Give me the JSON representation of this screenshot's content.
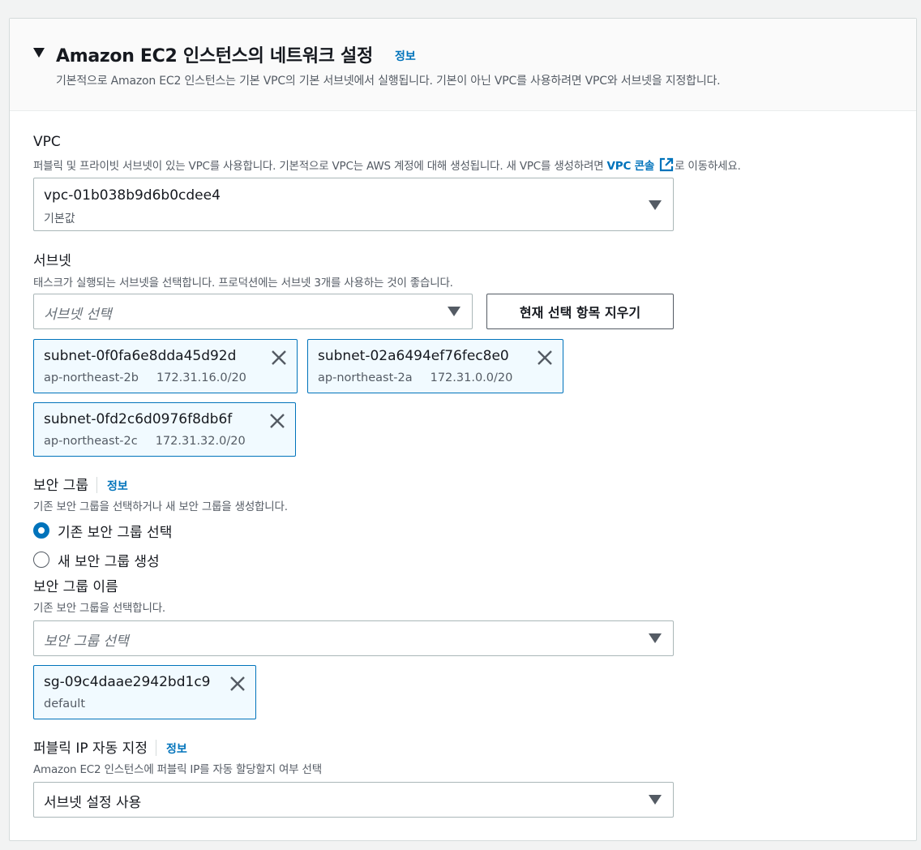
{
  "header": {
    "title": "Amazon EC2 인스턴스의 네트워크 설정",
    "info": "정보",
    "description": "기본적으로 Amazon EC2 인스턴스는 기본 VPC의 기본 서브넷에서 실행됩니다. 기본이 아닌 VPC를 사용하려면 VPC와 서브넷을 지정합니다."
  },
  "vpc": {
    "label": "VPC",
    "description_before": "퍼블릭 및 프라이빗 서브넷이 있는 VPC를 사용합니다. 기본적으로 VPC는 AWS 계정에 대해 생성됩니다. 새 VPC를 생성하려면 ",
    "console_link": "VPC 콘솔",
    "description_after": "로 이동하세요.",
    "selected_value": "vpc-01b038b9d6b0cdee4",
    "selected_sub": "기본값"
  },
  "subnet": {
    "label": "서브넷",
    "description": "태스크가 실행되는 서브넷을 선택합니다. 프로덕션에는 서브넷 3개를 사용하는 것이 좋습니다.",
    "placeholder": "서브넷 선택",
    "clear_button": "현재 선택 항목 지우기",
    "tokens": [
      {
        "id": "subnet-0f0fa6e8dda45d92d",
        "az": "ap-northeast-2b",
        "cidr": "172.31.16.0/20"
      },
      {
        "id": "subnet-02a6494ef76fec8e0",
        "az": "ap-northeast-2a",
        "cidr": "172.31.0.0/20"
      },
      {
        "id": "subnet-0fd2c6d0976f8db6f",
        "az": "ap-northeast-2c",
        "cidr": "172.31.32.0/20"
      }
    ]
  },
  "security_group": {
    "label": "보안 그룹",
    "info": "정보",
    "description": "기존 보안 그룹을 선택하거나 새 보안 그룹을 생성합니다.",
    "options": [
      {
        "label": "기존 보안 그룹 선택",
        "selected": true
      },
      {
        "label": "새 보안 그룹 생성",
        "selected": false
      }
    ],
    "name_label": "보안 그룹 이름",
    "name_description": "기존 보안 그룹을 선택합니다.",
    "placeholder": "보안 그룹 선택",
    "tokens": [
      {
        "id": "sg-09c4daae2942bd1c9",
        "name": "default"
      }
    ]
  },
  "public_ip": {
    "label": "퍼블릭 IP 자동 지정",
    "info": "정보",
    "description": "Amazon EC2 인스턴스에 퍼블릭 IP를 자동 할당할지 여부 선택",
    "selected_value": "서브넷 설정 사용"
  },
  "colors": {
    "link": "#0073bb",
    "token_bg": "#f1faff",
    "token_border": "#0073bb",
    "text": "#16191f",
    "muted": "#545b64"
  },
  "icons": {
    "expand": "caret-down-icon",
    "dropdown": "caret-down-icon",
    "remove": "close-icon",
    "external": "external-link-icon"
  }
}
